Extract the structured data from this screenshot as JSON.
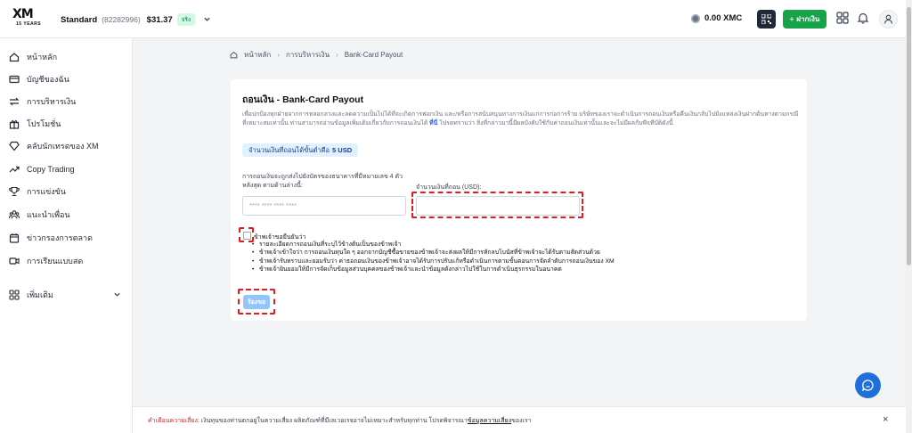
{
  "brand": {
    "logo_text": "XM",
    "logo_sub": "15 YEARS"
  },
  "account": {
    "name": "Standard",
    "number": "(82282996)",
    "balance": "$31.37",
    "badge": "จริง"
  },
  "header": {
    "xmc_balance": "0.00 XMC",
    "deposit_label": "ฝากเงิน"
  },
  "sidebar": {
    "items": [
      {
        "label": "หน้าหลัก",
        "icon": "home-icon"
      },
      {
        "label": "บัญชีของฉัน",
        "icon": "card-icon"
      },
      {
        "label": "การบริหารเงิน",
        "icon": "transfer-icon"
      },
      {
        "label": "โปรโมชั่น",
        "icon": "gift-icon"
      },
      {
        "label": "คลับนักเทรดของ XM",
        "icon": "diamond-icon"
      },
      {
        "label": "Copy Trading",
        "icon": "trend-icon"
      },
      {
        "label": "การแข่งขัน",
        "icon": "trophy-icon"
      },
      {
        "label": "แนะนำเพื่อน",
        "icon": "users-icon"
      },
      {
        "label": "ข่าวกรองการตลาด",
        "icon": "calendar-icon"
      },
      {
        "label": "การเรียนแบบสด",
        "icon": "video-icon"
      }
    ],
    "more_label": "เพิ่มเติม"
  },
  "breadcrumb": {
    "home": "หน้าหลัก",
    "section": "การบริหารเงิน",
    "current": "Bank-Card Payout"
  },
  "withdraw": {
    "title": "ถอนเงิน - Bank-Card Payout",
    "description": "เพื่อปกป้องทุกฝ่ายจากการหลอกลวงและลดความเป็นไปได้ที่จะเกิดการฟอกเงิน และ/หรือการสนับสนุนทางการเงินแก่การก่อการร้าย บริษัทของเราจะดำเนินการถอนเงินหรือคืนเงินกลับไปยังแหล่งเงินฝากต้นทางตามกรณีที่เหมาะสมเท่านั้น ท่านสามารถอ่านข้อมูลเพิ่มเติมเกี่ยวกับการถอนเงินได้",
    "description_link": "ที่นี่",
    "description_tail": "โปรดทราบว่า สิ่งที่กล่าวมานี้มีผลบังคับใช้กับค่าถอนเงินเท่านั้นและจะไม่มีผลกับพีจทีบัติดังนี้",
    "min_text": "จำนวนเงินที่ถอนได้ขั้นต่ำคือ",
    "min_value": "5 USD",
    "card_label": "การถอนเงินจะถูกส่งไปยังบัตรของธนาคารที่มีหมายเลข 4 ตัวหลังสุด ตามด้านล่างนี้:",
    "card_placeholder": "**** **** **** ****",
    "amount_label": "จำนวนเงินที่ถอน (USD):",
    "agree_heading": "ข้าพเจ้าขอยืนยันว่า",
    "terms": [
      "รายละเอียดการถอนเงินที่ระบุไว้ข้างต้นเป็นของข้าพเจ้า",
      "ข้าพเจ้าเข้าใจว่า การถอนเงินทุนใด ๆ ออกจากบัญชีซื้อขายของข้าพเจ้าจะส่งผลให้มีการหักลบโบนัสที่ข้าพเจ้าจะได้รับตามสัดส่วนด้วย",
      "ข้าพเจ้ารับทราบและยอมรับว่า ค่าธอถอนเงินของข้าพเจ้าอาจได้รับการปรับแก้หรือดำเนินการตามขั้นตอนการจัดลำดับการถอนเงินของ XM",
      "ข้าพเจ้ายินยอมให้มีการจัดเก็บข้อมูลส่วนบุคคลของข้าพเจ้าและนำข้อมูลดังกล่าวไปใช้ในการดำเนินธุรกรรมในอนาคต"
    ],
    "submit_label": "ร้องขอ"
  },
  "risk": {
    "warning_label": "คำเตือนความเสี่ยง:",
    "text": "เงินทุนของท่านตกอยู่ในความเสี่ยง ผลิตภัณฑ์ที่มีเลเวอเรจอาจไม่เหมาะสำหรับทุกท่าน โปรดพิจารณา",
    "link": "ข้อมูลความเสี่ยง",
    "tail": "ของเรา",
    "close": "×"
  },
  "colors": {
    "accent_green": "#16a34a",
    "annotation_red": "#e11d1d",
    "chat_blue": "#1e6fd9",
    "info_bg": "#e0f2fe"
  }
}
